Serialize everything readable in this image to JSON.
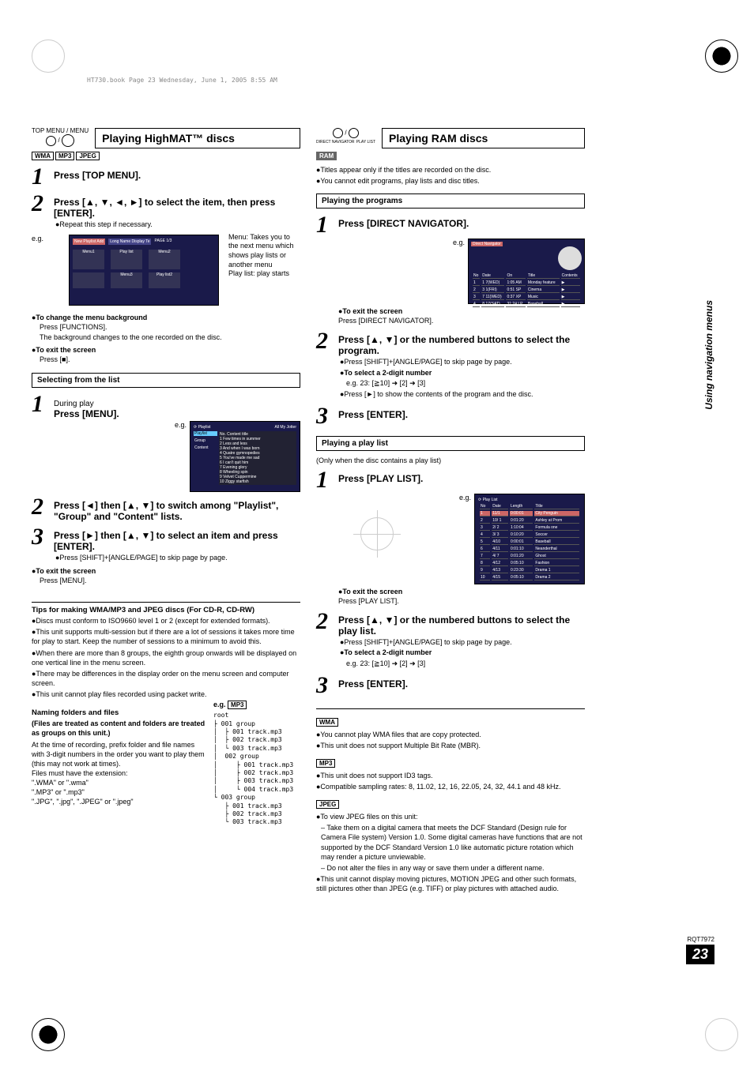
{
  "pageinfo": "HT730.book  Page 23  Wednesday, June 1, 2005  8:55 AM",
  "sidebar_label": "Using navigation menus",
  "rqt": "RQT7972",
  "pagenum": "23",
  "left": {
    "icons_top": "TOP MENU",
    "icons_menu": "MENU",
    "title": "Playing HighMAT™ discs",
    "tags": [
      "WMA",
      "MP3",
      "JPEG"
    ],
    "step1": "Press [TOP MENU].",
    "step2": "Press [▲, ▼, ◄, ►] to select the item, then press [ENTER].",
    "step2_sub": "●Repeat this step if necessary.",
    "eg": "e.g.",
    "menu_desc1": "Menu: Takes you to the next menu which shows play lists or another menu",
    "menu_desc2": "Play list: play starts",
    "change_bg_head": "●To change the menu background",
    "change_bg_1": "Press [FUNCTIONS].",
    "change_bg_2": "The background changes to the one recorded on the disc.",
    "exit_head": "●To exit the screen",
    "exit_1": "Press [■].",
    "section_select": "Selecting from the list",
    "s1_a": "During play",
    "s1_b": "Press [MENU].",
    "s2": "Press [◄] then [▲, ▼] to switch among \"Playlist\", \"Group\" and \"Content\" lists.",
    "s3": "Press [►] then [▲, ▼] to select an item and press [ENTER].",
    "s3_sub": "●Press [SHIFT]+[ANGLE/PAGE] to skip page by page.",
    "exit2_head": "●To exit the screen",
    "exit2_1": "Press [MENU].",
    "tips_head": "Tips for making WMA/MP3 and JPEG discs (For CD-R, CD-RW)",
    "tips": [
      "●Discs must conform to ISO9660 level 1 or 2 (except for extended formats).",
      "●This unit supports multi-session but if there are a lot of sessions it takes more time for play to start. Keep the number of sessions to a minimum to avoid this.",
      "●When there are more than 8 groups, the eighth group onwards will be displayed on one vertical line in the menu screen.",
      "●There may be differences in the display order on the menu screen and computer screen.",
      "●This unit cannot play files recorded using packet write."
    ],
    "naming_head": "Naming folders and files",
    "naming_bold": "(Files are treated as content and folders are treated as groups on this unit.)",
    "naming_body": "At the time of recording, prefix folder and file names with 3-digit numbers in the order you want to play them (this may not work at times).\nFiles must have the extension:\n\".WMA\" or \".wma\"\n\".MP3\" or \".mp3\"\n\".JPG\", \".jpg\", \".JPEG\" or \".jpeg\"",
    "tree_eg": "e.g.",
    "tree_tag": "MP3",
    "tree": {
      "root": "root",
      "g1": "001 group",
      "g1f": [
        "001 track.mp3",
        "002 track.mp3",
        "003 track.mp3"
      ],
      "g2": "002 group",
      "g2f": [
        "001 track.mp3",
        "002 track.mp3",
        "003 track.mp3",
        "004 track.mp3"
      ],
      "g3": "003 group",
      "g3f": [
        "001 track.mp3",
        "002 track.mp3",
        "003 track.mp3"
      ]
    }
  },
  "right": {
    "icons_dn": "DIRECT NAVIGATOR",
    "icons_pl": "PLAY LIST",
    "title": "Playing RAM discs",
    "tag": "RAM",
    "intro1": "●Titles appear only if the titles are recorded on the disc.",
    "intro2": "●You cannot edit programs, play lists and disc titles.",
    "section_prog": "Playing the programs",
    "p1": "Press [DIRECT NAVIGATOR].",
    "eg": "e.g.",
    "exit1_head": "●To exit the screen",
    "exit1_1": "Press [DIRECT NAVIGATOR].",
    "p2": "Press [▲, ▼] or the numbered buttons to select the program.",
    "p2_sub1": "●Press [SHIFT]+[ANGLE/PAGE] to skip page by page.",
    "p2_sub2_head": "●To select a 2-digit number",
    "p2_sub2": "e.g. 23: [≧10] ➜ [2] ➜ [3]",
    "p2_sub3": "●Press [►] to show the contents of the program and the disc.",
    "p3": "Press [ENTER].",
    "section_play": "Playing a play list",
    "play_cond": "(Only when the disc contains a play list)",
    "pl1": "Press [PLAY LIST].",
    "pl_exit_head": "●To exit the screen",
    "pl_exit_1": "Press [PLAY LIST].",
    "pl2": "Press [▲, ▼] or the numbered buttons to select the play list.",
    "pl2_sub1": "●Press [SHIFT]+[ANGLE/PAGE] to skip page by page.",
    "pl2_sub2_head": "●To select a 2-digit number",
    "pl2_sub2": "e.g. 23: [≧10] ➜ [2] ➜ [3]",
    "pl3": "Press [ENTER].",
    "wma_tag": "WMA",
    "wma1": "●You cannot play WMA files that are copy protected.",
    "wma2": "●This unit does not support Multiple Bit Rate (MBR).",
    "mp3_tag": "MP3",
    "mp31": "●This unit does not support ID3 tags.",
    "mp32": "●Compatible sampling rates: 8, 11.02, 12, 16, 22.05, 24, 32, 44.1 and 48 kHz.",
    "jpeg_tag": "JPEG",
    "jpeg1": "●To view JPEG files on this unit:",
    "jpeg1a": "– Take them on a digital camera that meets the DCF Standard (Design rule for Camera File system) Version 1.0. Some digital cameras have functions that are not supported by the DCF Standard Version 1.0 like automatic picture rotation which may render a picture unviewable.",
    "jpeg1b": "– Do not alter the files in any way or save them under a different name.",
    "jpeg2": "●This unit cannot display moving pictures, MOTION JPEG and other such formats, still pictures other than JPEG (e.g. TIFF) or play pictures with attached audio.",
    "nav_table": {
      "header": [
        "No",
        "Date",
        "On",
        "Title",
        "Contents"
      ],
      "rows": [
        [
          "1",
          "1 7(WED)",
          "1:05 AM",
          "Monday feature",
          ""
        ],
        [
          "2",
          "3 1(FRI)",
          "0:51 SP",
          "Cinema",
          ""
        ],
        [
          "3",
          "7 11(WED)",
          "0:37 XP",
          "Music",
          ""
        ],
        [
          "4",
          "8 17(SAT)",
          "31:24 LP",
          "Baseball",
          ""
        ]
      ]
    },
    "pl_table": {
      "header": [
        "No",
        "Date",
        "Length",
        "Title"
      ],
      "rows": [
        [
          "1",
          "11/1",
          "0:00:01",
          "City Penguin"
        ],
        [
          "2",
          "10/ 1",
          "0:01:20",
          "Ashley at Prom"
        ],
        [
          "3",
          "2/ 2",
          "1:10:04",
          "Formula one"
        ],
        [
          "4",
          "3/ 3",
          "0:10:20",
          "Soccer"
        ],
        [
          "5",
          "4/10",
          "0:00:01",
          "Baseball"
        ],
        [
          "6",
          "4/11",
          "0:01:10",
          "Neanderthal"
        ],
        [
          "7",
          "4/ 7",
          "0:01:20",
          "Ghost"
        ],
        [
          "8",
          "4/12",
          "0:05:10",
          "Fashion"
        ],
        [
          "9",
          "4/13",
          "0:23:30",
          "Drama 1"
        ],
        [
          "10",
          "4/15",
          "0:05:10",
          "Drama 2"
        ]
      ]
    }
  },
  "chart_data": {
    "type": "table",
    "title": "Direct Navigator program list",
    "columns": [
      "No",
      "Date",
      "On",
      "Title"
    ],
    "rows": [
      [
        1,
        "1 7(WED)",
        "1:05 AM",
        "Monday feature"
      ],
      [
        2,
        "3 1(FRI)",
        "0:51 SP",
        "Cinema"
      ],
      [
        3,
        "7 11(WED)",
        "0:37 XP",
        "Music"
      ],
      [
        4,
        "8 17(SAT)",
        "31:24 LP",
        "Baseball"
      ]
    ]
  }
}
